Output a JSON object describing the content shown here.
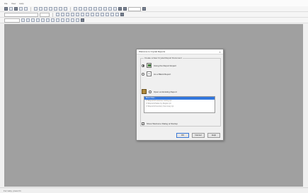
{
  "menubar": {
    "items": [
      "File",
      "View",
      "Help"
    ]
  },
  "dialog": {
    "title": "Welcome to Crystal Reports",
    "close": "×",
    "group_label": "Create a New Crystal Report Document",
    "options": [
      {
        "icon": "report-wizard-icon",
        "label": "Using the Report Expert",
        "selected": true
      },
      {
        "icon": "blank-report-icon",
        "label": "As a Blank Report",
        "selected": false
      },
      {
        "icon": "open-folder-icon",
        "label": "Open an Existing Report",
        "selected": false
      }
    ],
    "recent_files": [
      "More Files...",
      "C:\\Reports\\Customer Listing.rpt",
      "C:\\Reports\\Sales by Region.rpt",
      "C:\\Reports\\Inventory Summary.rpt"
    ],
    "show_again_label": "Show Welcome Dialog at Startup",
    "show_again_checked": true,
    "buttons": {
      "ok": "OK",
      "cancel": "Cancel",
      "help": "Help"
    }
  },
  "statusbar": {
    "left": "For Help, press F1",
    "right": ""
  }
}
